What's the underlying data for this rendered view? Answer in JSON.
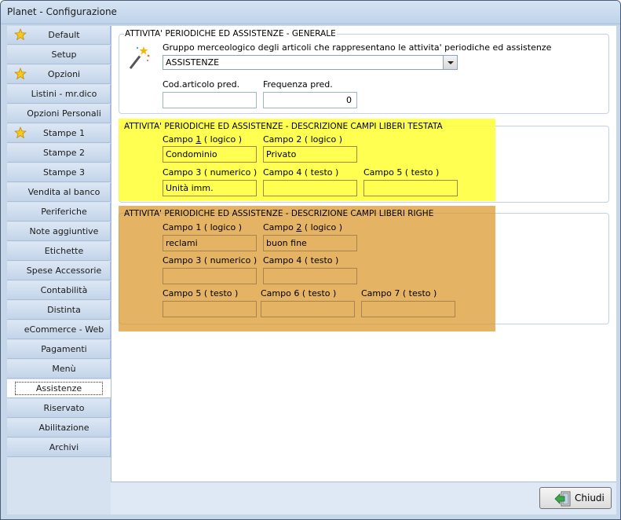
{
  "window": {
    "title": "Planet - Configurazione"
  },
  "sidebar": {
    "items": [
      {
        "label": "Default",
        "star": true
      },
      {
        "label": "Setup",
        "star": false
      },
      {
        "label": "Opzioni",
        "star": true
      },
      {
        "label": "Listini - mr.dico",
        "star": false
      },
      {
        "label": "Opzioni Personali",
        "star": false
      },
      {
        "label": "Stampe 1",
        "star": true
      },
      {
        "label": "Stampe 2",
        "star": false
      },
      {
        "label": "Stampe 3",
        "star": false
      },
      {
        "label": "Vendita al banco",
        "star": false
      },
      {
        "label": "Periferiche",
        "star": false
      },
      {
        "label": "Note aggiuntive",
        "star": false
      },
      {
        "label": "Etichette",
        "star": false
      },
      {
        "label": "Spese Accessorie",
        "star": false
      },
      {
        "label": "Contabilità",
        "star": false
      },
      {
        "label": "Distinta",
        "star": false
      },
      {
        "label": "eCommerce - Web",
        "star": false
      },
      {
        "label": "Pagamenti",
        "star": false
      },
      {
        "label": "Menù",
        "star": false
      },
      {
        "label": "Assistenze",
        "star": false,
        "active": true
      },
      {
        "label": "Riservato",
        "star": false
      },
      {
        "label": "Abilitazione",
        "star": false
      },
      {
        "label": "Archivi",
        "star": false
      }
    ]
  },
  "generale": {
    "title": "ATTIVITA' PERIODICHE ED ASSISTENZE - GENERALE",
    "gruppo_label": "Gruppo merceologico degli articoli che rappresentano le attivita' periodiche ed assistenze",
    "gruppo_value": "ASSISTENZE",
    "cod_label": "Cod.articolo pred.",
    "cod_value": "",
    "freq_label": "Frequenza pred.",
    "freq_value": "0"
  },
  "testata": {
    "title": "ATTIVITA' PERIODICHE ED ASSISTENZE - DESCRIZIONE CAMPI LIBERI TESTATA",
    "campo1_label_pre": "Campo ",
    "campo1_label_num": "1",
    "campo1_label_post": " ( logico )",
    "campo1_value": "Condominio",
    "campo2_label": "Campo 2 ( logico )",
    "campo2_value": "Privato",
    "campo3_label": "Campo 3 ( numerico )",
    "campo3_value": "Unità imm.",
    "campo4_label": "Campo 4 ( testo )",
    "campo4_value": "",
    "campo5_label": "Campo 5 ( testo )",
    "campo5_value": ""
  },
  "righe": {
    "title": "ATTIVITA' PERIODICHE ED ASSISTENZE - DESCRIZIONE CAMPI LIBERI RIGHE",
    "campo1_label": "Campo 1 ( logico )",
    "campo1_value": "reclami",
    "campo2_label_pre": "Campo ",
    "campo2_label_num": "2",
    "campo2_label_post": " ( logico )",
    "campo2_value": "buon fine",
    "campo3_label": "Campo 3 ( numerico )",
    "campo3_value": "",
    "campo4_label": "Campo 4 ( testo )",
    "campo4_value": "",
    "campo5_label": "Campo 5 ( testo )",
    "campo5_value": "",
    "campo6_label": "Campo 6 ( testo )",
    "campo6_value": "",
    "campo7_label": "Campo 7 ( testo )",
    "campo7_value": ""
  },
  "footer": {
    "close_label": "Chiudi"
  },
  "colors": {
    "highlight_yellow": "#ffff33",
    "highlight_orange": "#d99628",
    "window_frame": "#c6d7ea"
  }
}
